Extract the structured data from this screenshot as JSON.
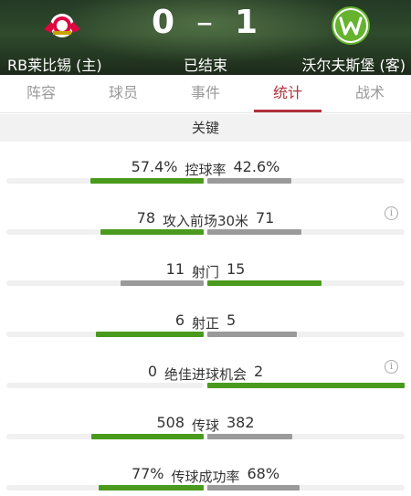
{
  "header": {
    "home_team": "RB莱比锡 (主)",
    "away_team": "沃尔夫斯堡 (客)",
    "home_score": "0",
    "away_score": "1",
    "separator": "–",
    "status": "已结束",
    "home_logo_icon": "rb-leipzig-logo-icon",
    "away_logo_icon": "wolfsburg-logo-icon"
  },
  "tabs": [
    {
      "label": "阵容",
      "active": false
    },
    {
      "label": "球员",
      "active": false
    },
    {
      "label": "事件",
      "active": false
    },
    {
      "label": "统计",
      "active": true
    },
    {
      "label": "战术",
      "active": false
    }
  ],
  "section": {
    "title": "关键"
  },
  "colors": {
    "leader": "#4a9a1e",
    "trailer": "#9a9a9a",
    "accent": "#b0323a"
  },
  "stats": [
    {
      "label": "控球率",
      "home": "57.4%",
      "away": "42.6%",
      "home_value": 57.4,
      "away_value": 42.6,
      "info": false
    },
    {
      "label": "攻入前场30米",
      "home": "78",
      "away": "71",
      "home_value": 78,
      "away_value": 71,
      "info": true
    },
    {
      "label": "射门",
      "home": "11",
      "away": "15",
      "home_value": 11,
      "away_value": 15,
      "info": false
    },
    {
      "label": "射正",
      "home": "6",
      "away": "5",
      "home_value": 6,
      "away_value": 5,
      "info": false
    },
    {
      "label": "绝佳进球机会",
      "home": "0",
      "away": "2",
      "home_value": 0,
      "away_value": 2,
      "info": true
    },
    {
      "label": "传球",
      "home": "508",
      "away": "382",
      "home_value": 508,
      "away_value": 382,
      "info": false
    },
    {
      "label": "传球成功率",
      "home": "77%",
      "away": "68%",
      "home_value": 77,
      "away_value": 68,
      "info": false
    }
  ]
}
